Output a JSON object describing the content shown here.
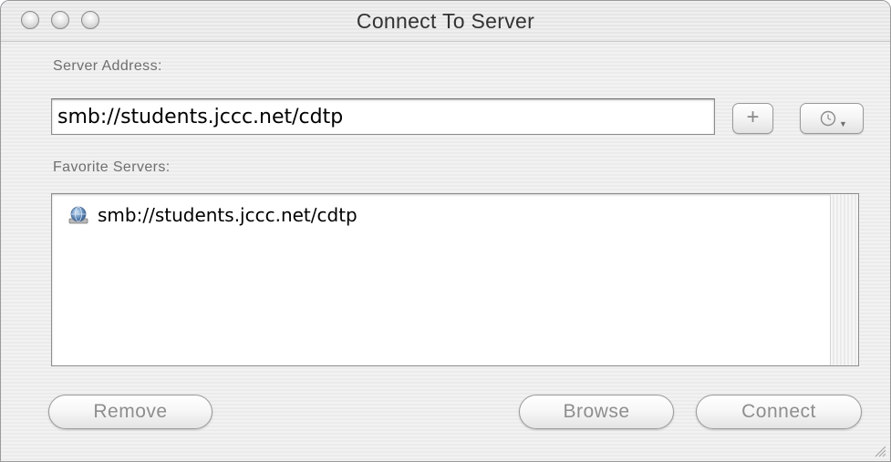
{
  "window": {
    "title": "Connect To Server"
  },
  "server_address": {
    "label": "Server Address:",
    "value": "smb://students.jccc.net/cdtp",
    "add_button_label": "+",
    "recent_button_icon": "clock-icon"
  },
  "favorites": {
    "label": "Favorite Servers:",
    "items": [
      {
        "label": "smb://students.jccc.net/cdtp",
        "icon": "network-server-icon"
      }
    ]
  },
  "buttons": {
    "remove": "Remove",
    "browse": "Browse",
    "connect": "Connect"
  }
}
